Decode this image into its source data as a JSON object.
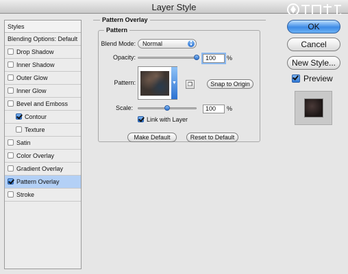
{
  "window": {
    "title": "Layer Style"
  },
  "styles_panel": {
    "header": "Styles",
    "blending_options": "Blending Options: Default",
    "items": [
      {
        "label": "Drop Shadow",
        "checked": false
      },
      {
        "label": "Inner Shadow",
        "checked": false
      },
      {
        "label": "Outer Glow",
        "checked": false
      },
      {
        "label": "Inner Glow",
        "checked": false
      },
      {
        "label": "Bevel and Emboss",
        "checked": false
      },
      {
        "label": "Contour",
        "checked": true
      },
      {
        "label": "Texture",
        "checked": false
      },
      {
        "label": "Satin",
        "checked": false
      },
      {
        "label": "Color Overlay",
        "checked": false
      },
      {
        "label": "Gradient Overlay",
        "checked": false
      },
      {
        "label": "Pattern Overlay",
        "checked": true,
        "selected": true
      },
      {
        "label": "Stroke",
        "checked": false
      }
    ]
  },
  "pattern_overlay": {
    "section_title": "Pattern Overlay",
    "group_title": "Pattern",
    "blend_mode_label": "Blend Mode:",
    "blend_mode_value": "Normal",
    "opacity_label": "Opacity:",
    "opacity_value": "100",
    "opacity_fraction": 1.0,
    "percent_sign": "%",
    "pattern_label": "Pattern:",
    "snap_to_origin": "Snap to Origin",
    "scale_label": "Scale:",
    "scale_value": "100",
    "scale_fraction": 0.5,
    "link_with_layer": "Link with Layer",
    "link_with_layer_checked": true,
    "make_default": "Make Default",
    "reset_to_default": "Reset to Default"
  },
  "side_buttons": {
    "ok": "OK",
    "cancel": "Cancel",
    "new_style": "New Style...",
    "preview": "Preview",
    "preview_checked": true
  },
  "colors": {
    "selection": "#b3d0f6",
    "accent_blue": "#2e73d2"
  }
}
